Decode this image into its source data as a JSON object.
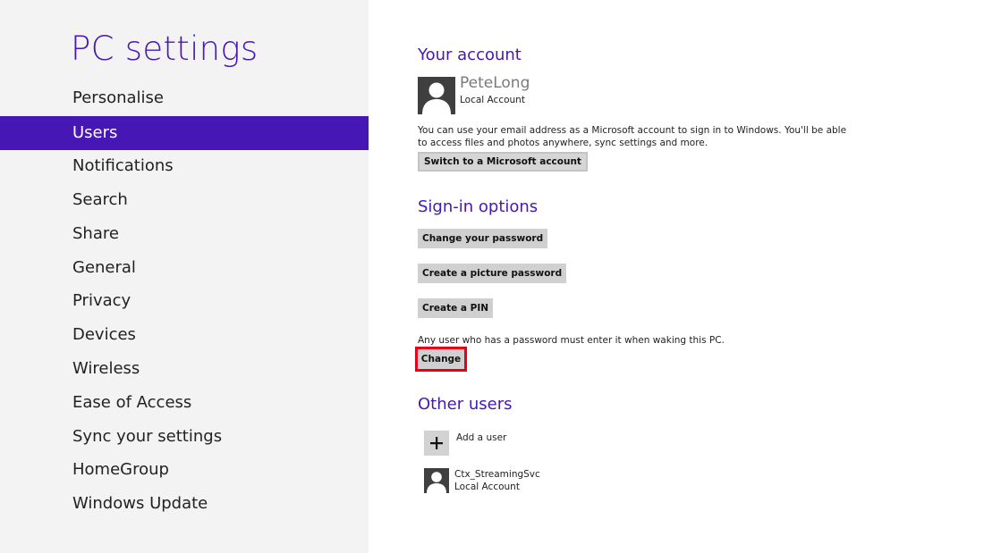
{
  "sidebar": {
    "title": "PC settings",
    "selected": "Users",
    "items": [
      {
        "label": "Personalise"
      },
      {
        "label": "Users"
      },
      {
        "label": "Notifications"
      },
      {
        "label": "Search"
      },
      {
        "label": "Share"
      },
      {
        "label": "General"
      },
      {
        "label": "Privacy"
      },
      {
        "label": "Devices"
      },
      {
        "label": "Wireless"
      },
      {
        "label": "Ease of Access"
      },
      {
        "label": "Sync your settings"
      },
      {
        "label": "HomeGroup"
      },
      {
        "label": "Windows Update"
      }
    ]
  },
  "account": {
    "heading": "Your account",
    "name": "PeteLong",
    "type": "Local Account",
    "description_line1": "You can use your email address as a Microsoft account to sign in to Windows. You'll be able",
    "description_line2": "to access files and photos anywhere, sync settings and more.",
    "switch_button": "Switch to a Microsoft account"
  },
  "signin": {
    "heading": "Sign-in options",
    "change_password": "Change your password",
    "picture_password": "Create a picture password",
    "create_pin": "Create a PIN",
    "wake_note": "Any user who has a password must enter it when waking this PC.",
    "change_button": "Change"
  },
  "other_users": {
    "heading": "Other users",
    "add_user": "Add a user",
    "users": [
      {
        "name": "Ctx_StreamingSvc",
        "type": "Local Account"
      }
    ]
  },
  "colors": {
    "accent": "#4617b4",
    "sidebar_bg": "#f3f3f3",
    "highlight_outline": "#e8001a"
  }
}
